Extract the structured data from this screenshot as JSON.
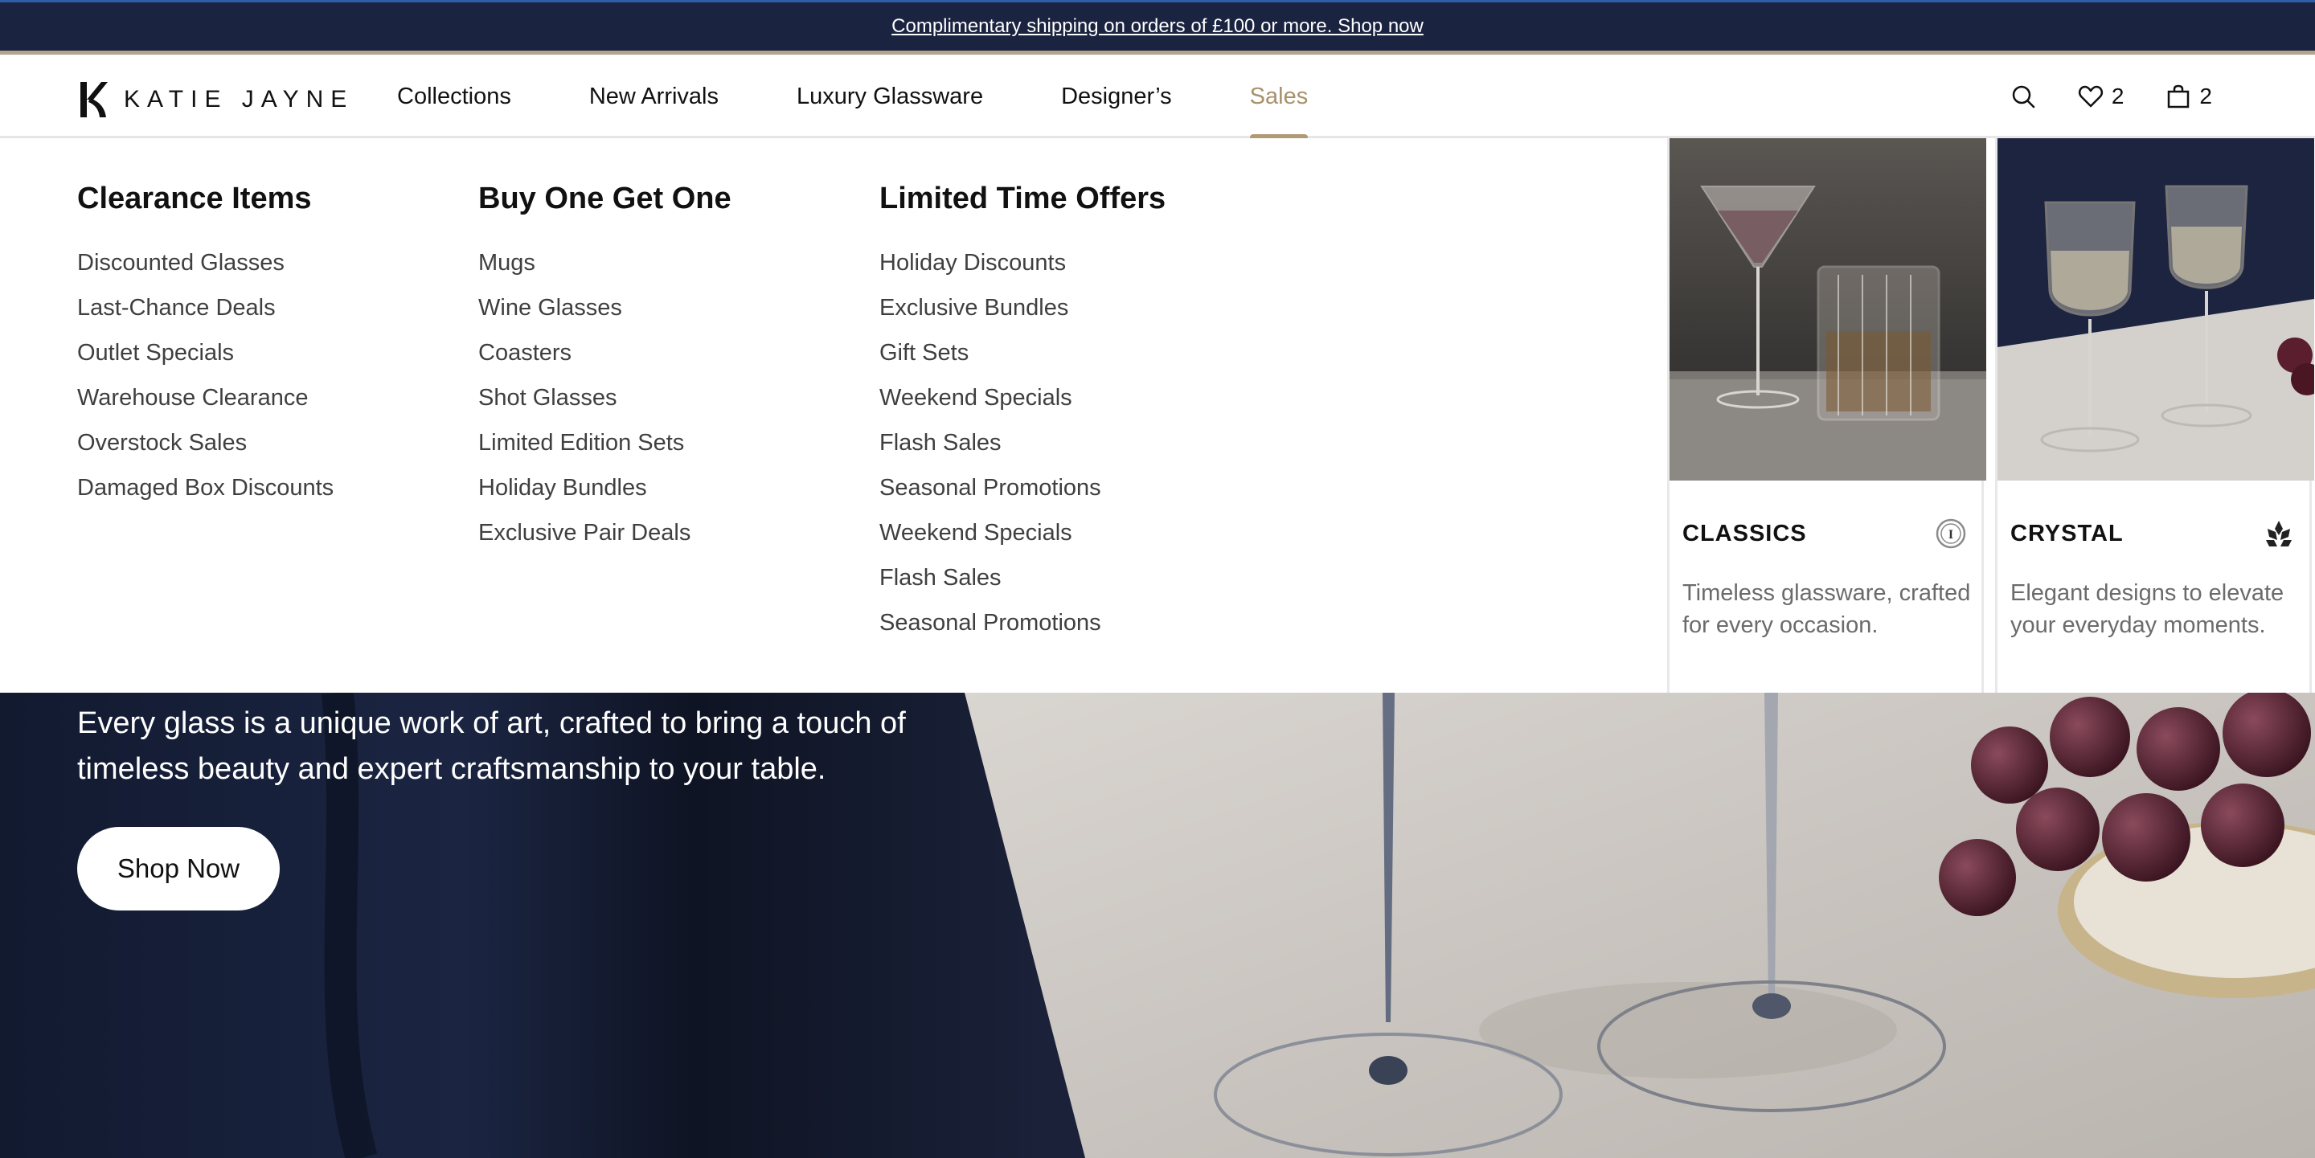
{
  "announcement": {
    "text": "Complimentary shipping on orders of £100 or more. Shop now"
  },
  "brand": {
    "name": "KATIE JAYNE",
    "accent": "#b09a75",
    "navy": "#1a2340"
  },
  "nav": {
    "items": [
      {
        "label": "Collections"
      },
      {
        "label": "New Arrivals"
      },
      {
        "label": "Luxury Glassware"
      },
      {
        "label": "Designer’s"
      },
      {
        "label": "Sales",
        "active": true
      }
    ]
  },
  "tools": {
    "wishlist_count": "2",
    "cart_count": "2",
    "search_icon": "search-icon",
    "heart_icon": "heart-icon",
    "bag_icon": "bag-icon"
  },
  "mega_menu": {
    "columns": [
      {
        "title": "Clearance Items",
        "links": [
          "Discounted Glasses",
          "Last-Chance Deals",
          "Outlet Specials",
          "Warehouse Clearance",
          "Overstock Sales",
          "Damaged Box Discounts"
        ]
      },
      {
        "title": "Buy One Get One",
        "links": [
          "Mugs",
          "Wine Glasses",
          "Coasters",
          "Shot Glasses",
          "Limited Edition Sets",
          "Holiday Bundles",
          "Exclusive Pair Deals"
        ]
      },
      {
        "title": "Limited Time Offers",
        "links": [
          "Holiday Discounts",
          "Exclusive Bundles",
          "Gift Sets",
          "Weekend Specials",
          "Flash Sales",
          "Seasonal Promotions",
          "Weekend Specials",
          "Flash Sales",
          "Seasonal Promotions"
        ]
      }
    ],
    "cards": [
      {
        "title": "CLASSICS",
        "description": "Timeless glassware, crafted for every occasion.",
        "icon": "coin-icon"
      },
      {
        "title": "CRYSTAL",
        "description": "Elegant designs to elevate your everyday moments.",
        "icon": "lotus-icon"
      }
    ]
  },
  "hero": {
    "text": "Every glass is a unique work of art, crafted to bring a touch of timeless beauty and expert craftsmanship to your table.",
    "button_label": "Shop Now"
  }
}
